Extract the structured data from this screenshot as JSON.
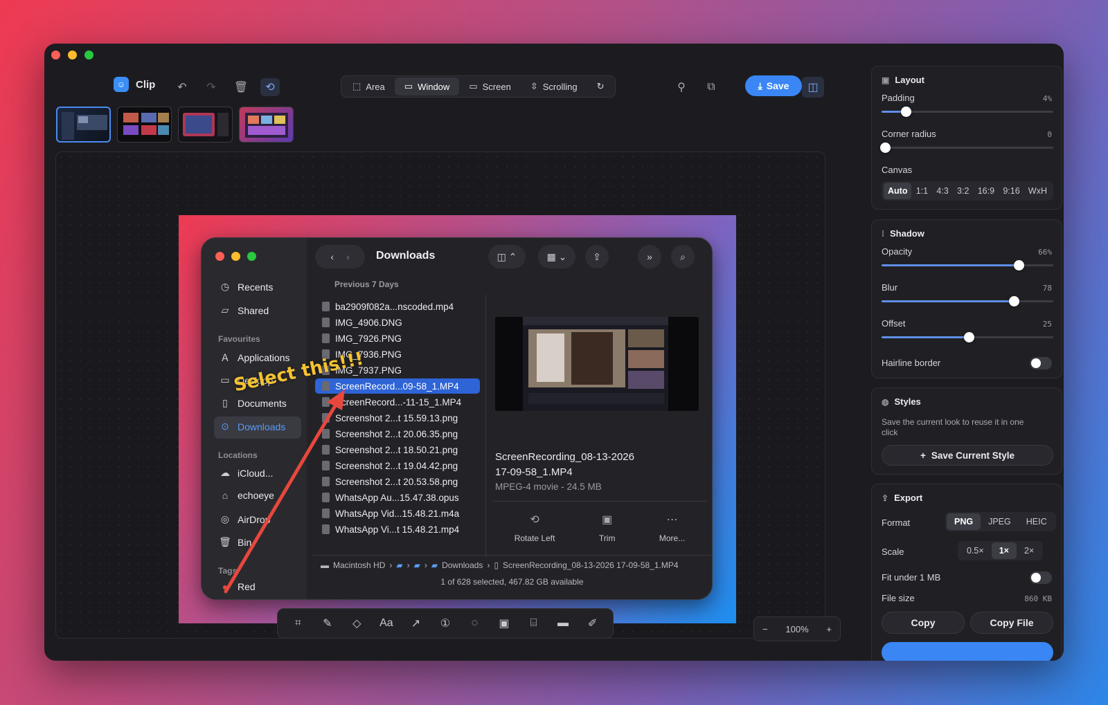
{
  "app": {
    "name": "Clip"
  },
  "capture_modes": [
    {
      "label": "Area",
      "selected": false
    },
    {
      "label": "Window",
      "selected": true
    },
    {
      "label": "Screen",
      "selected": false
    },
    {
      "label": "Scrolling",
      "selected": false
    }
  ],
  "toolbar": {
    "save_label": "Save"
  },
  "finder": {
    "title": "Downloads",
    "sidebar": {
      "recents": "Recents",
      "shared": "Shared",
      "favourites_header": "Favourites",
      "applications": "Applications",
      "desktop": "Desktop",
      "documents": "Documents",
      "downloads": "Downloads",
      "locations_header": "Locations",
      "icloud": "iCloud...",
      "home": "echoeye",
      "airdrop": "AirDrop",
      "bin": "Bin",
      "tags_header": "Tags",
      "red": "Red"
    },
    "group_header": "Previous 7 Days",
    "files": [
      "ba2909f082a...nscoded.mp4",
      "IMG_4906.DNG",
      "IMG_7926.PNG",
      "IMG_7936.PNG",
      "IMG_7937.PNG",
      "ScreenRecord...09-58_1.MP4",
      "ScreenRecord...-11-15_1.MP4",
      "Screenshot 2...t 15.59.13.png",
      "Screenshot 2...t 20.06.35.png",
      "Screenshot 2...t 18.50.21.png",
      "Screenshot 2...t 19.04.42.png",
      "Screenshot 2...t 20.53.58.png",
      "WhatsApp Au...15.47.38.opus",
      "WhatsApp Vid...15.48.21.m4a",
      "WhatsApp Vi...t 15.48.21.mp4"
    ],
    "selected_index": 5,
    "preview_name_line1": "ScreenRecording_08-13-2026",
    "preview_name_line2": "17-09-58_1.MP4",
    "preview_meta": "MPEG-4 movie - 24.5 MB",
    "actions": [
      "Rotate Left",
      "Trim",
      "More..."
    ],
    "path": [
      "Macintosh HD",
      "Downloads",
      "ScreenRecording_08-13-2026 17-09-58_1.MP4"
    ],
    "status": "1 of 628 selected, 467.82 GB available"
  },
  "annotation": {
    "text": "Select this!!!",
    "color": "#f5c231",
    "arrow_color": "#e8473e"
  },
  "zoom": {
    "value": "100%"
  },
  "panel": {
    "layout": {
      "title": "Layout",
      "padding_label": "Padding",
      "padding_value": "4%",
      "padding_level": 0.14,
      "corner_label": "Corner radius",
      "corner_value": "0",
      "corner_level": 0.02,
      "canvas_label": "Canvas",
      "canvas_options": [
        "Auto",
        "1:1",
        "4:3",
        "3:2",
        "16:9",
        "9:16",
        "WxH"
      ]
    },
    "shadow": {
      "title": "Shadow",
      "opacity_label": "Opacity",
      "opacity_value": "66%",
      "opacity_level": 0.8,
      "blur_label": "Blur",
      "blur_value": "78",
      "blur_level": 0.77,
      "offset_label": "Offset",
      "offset_value": "25",
      "offset_level": 0.51,
      "hairline_label": "Hairline border"
    },
    "styles": {
      "title": "Styles",
      "desc": "Save the current look to reuse it in one click",
      "button": "Save Current Style"
    },
    "export": {
      "title": "Export",
      "format_label": "Format",
      "formats": [
        "PNG",
        "JPEG",
        "HEIC"
      ],
      "scale_label": "Scale",
      "scales": [
        "0.5×",
        "1×",
        "2×"
      ],
      "fit_label": "Fit under 1 MB",
      "filesize_label": "File size",
      "filesize_value": "860 KB",
      "copy_label": "Copy",
      "copyfile_label": "Copy File"
    }
  },
  "colors": {
    "accent": "#3a86f4",
    "selection": "#2e64d6"
  }
}
